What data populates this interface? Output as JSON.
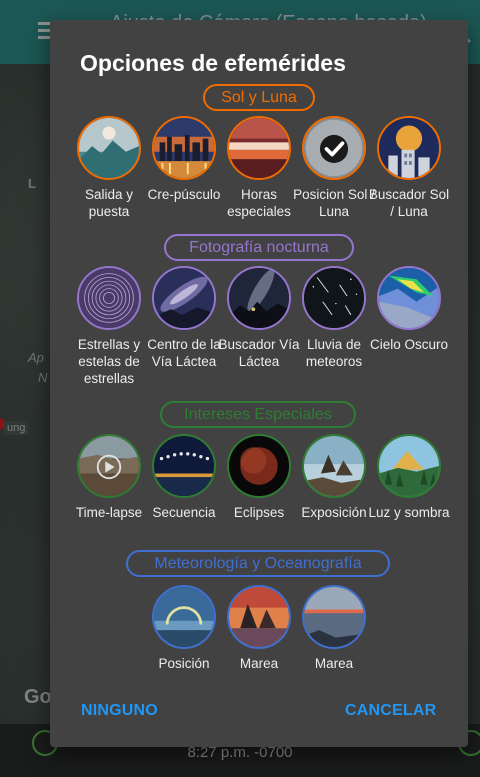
{
  "background": {
    "title": "Ajuste de Cámara (Escena basada)",
    "map_labels": [
      "Ap",
      "N",
      "L"
    ],
    "map_badge": "ung",
    "brand": "Go",
    "time": "8:27 p.m. -0700"
  },
  "dialog": {
    "title": "Opciones de efemérides",
    "sections": [
      {
        "label": "Sol y Luna",
        "color": "#ef6c00",
        "items": [
          {
            "label": "Salida y puesta",
            "icon": "moonrise-mountains-icon"
          },
          {
            "label": "Cre-púsculo",
            "icon": "city-twilight-icon"
          },
          {
            "label": "Horas especiales",
            "icon": "sunset-clouds-icon"
          },
          {
            "label": "Posicion Sol / Luna",
            "icon": "checkmark-selected-icon"
          },
          {
            "label": "Buscador Sol / Luna",
            "icon": "moon-building-icon"
          }
        ]
      },
      {
        "label": "Fotografía nocturna",
        "color": "#9575cd",
        "items": [
          {
            "label": "Estrellas y estelas de estrellas",
            "icon": "star-trails-icon"
          },
          {
            "label": "Centro de la Vía Láctea",
            "icon": "milky-way-center-icon"
          },
          {
            "label": "Buscador Vía Láctea",
            "icon": "milky-way-finder-icon"
          },
          {
            "label": "Lluvia de meteoros",
            "icon": "meteor-shower-icon"
          },
          {
            "label": "Cielo Oscuro",
            "icon": "dark-sky-map-icon"
          }
        ]
      },
      {
        "label": "Intereses Especiales",
        "color": "#2e7d32",
        "items": [
          {
            "label": "Time-lapse",
            "icon": "timelapse-play-icon"
          },
          {
            "label": "Secuencia",
            "icon": "sequence-bridge-icon"
          },
          {
            "label": "Eclipses",
            "icon": "eclipse-moon-icon"
          },
          {
            "label": "Exposición",
            "icon": "exposure-seascape-icon"
          },
          {
            "label": "Luz y sombra",
            "icon": "light-shadow-valley-icon"
          }
        ]
      },
      {
        "label": "Meteorología y Oceanografía",
        "color": "#3f6fd0",
        "items": [
          {
            "label": "Posición",
            "icon": "rainbow-position-icon"
          },
          {
            "label": "Marea",
            "icon": "tide-rocks-icon"
          },
          {
            "label": "Marea",
            "icon": "tide-shore-icon"
          }
        ]
      }
    ],
    "buttons": {
      "none": "NINGUNO",
      "cancel": "CANCELAR"
    }
  }
}
